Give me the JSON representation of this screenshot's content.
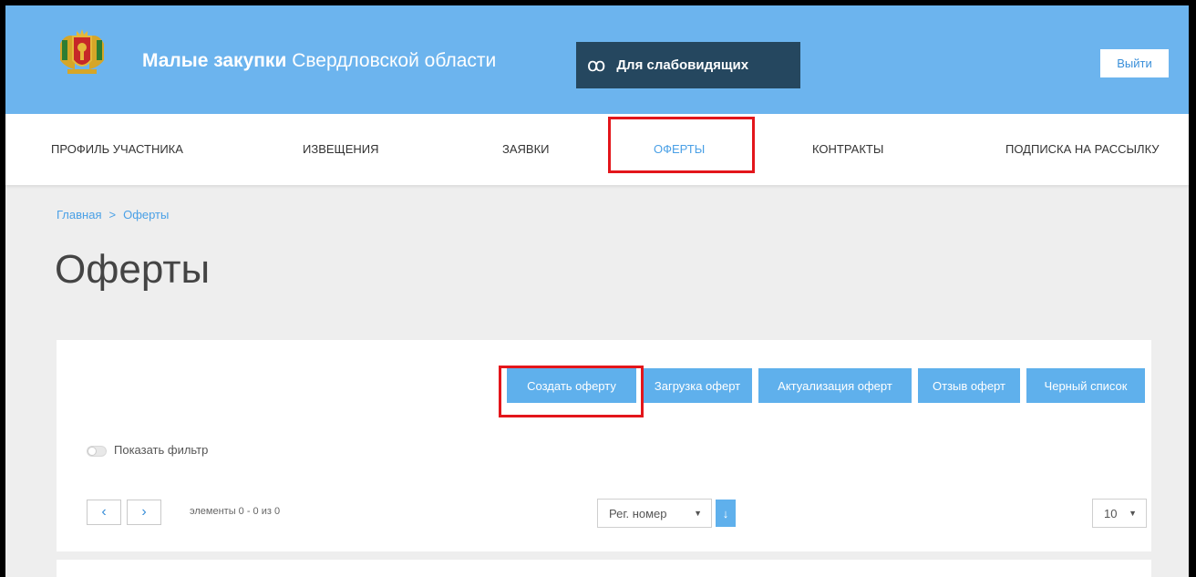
{
  "header": {
    "title_bold": "Малые закупки",
    "title_regular": "Свердловской области",
    "accessibility_label": "Для слабовидящих",
    "accessibility_icon": "glasses-icon",
    "logout_label": "Выйти",
    "background": "#6cb4ee"
  },
  "nav": {
    "items": [
      {
        "label": "ПРОФИЛЬ УЧАСТНИКА"
      },
      {
        "label": "ИЗВЕЩЕНИЯ"
      },
      {
        "label": "ЗАЯВКИ"
      },
      {
        "label": "ОФЕРТЫ",
        "active": true
      },
      {
        "label": "КОНТРАКТЫ"
      },
      {
        "label": "ПОДПИСКА НА РАССЫЛКУ"
      }
    ]
  },
  "breadcrumb": {
    "home": "Главная",
    "separator": ">",
    "current": "Оферты"
  },
  "page_title": "Оферты",
  "toolbar": {
    "create": "Создать оферту",
    "upload": "Загрузка оферт",
    "update": "Актуализация оферт",
    "revoke": "Отзыв оферт",
    "blacklist": "Черный список"
  },
  "filter": {
    "label": "Показать фильтр"
  },
  "pager": {
    "prev_icon": "chevron-left-icon",
    "next_icon": "chevron-right-icon",
    "info": "элементы 0 - 0 из 0"
  },
  "sort": {
    "selected": "Рег. номер",
    "direction_icon": "arrow-down-icon"
  },
  "page_size": {
    "selected": "10"
  },
  "colors": {
    "accent": "#5fb0ec",
    "highlight": "#e3161b",
    "dark_button": "#25475f"
  }
}
